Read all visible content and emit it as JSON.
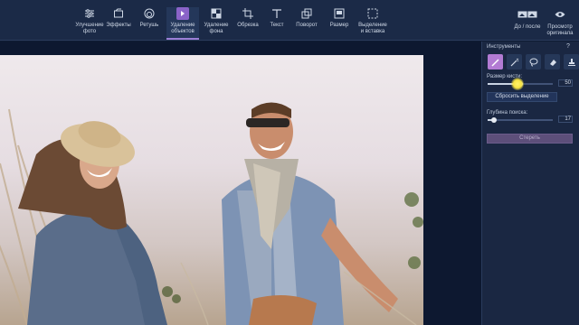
{
  "toolbar": {
    "items": [
      {
        "id": "enhance",
        "label_line1": "Улучшение",
        "label_line2": "фото",
        "icon": "sliders-icon"
      },
      {
        "id": "effects",
        "label_line1": "Эффекты",
        "label_line2": "",
        "icon": "effects-icon"
      },
      {
        "id": "retouch",
        "label_line1": "Ретушь",
        "label_line2": "",
        "icon": "retouch-icon"
      },
      {
        "id": "object-removal",
        "label_line1": "Удаление",
        "label_line2": "объектов",
        "icon": "eraser-icon",
        "active": true
      },
      {
        "id": "bg-removal",
        "label_line1": "Удаление",
        "label_line2": "фона",
        "icon": "background-icon"
      },
      {
        "id": "crop",
        "label_line1": "Обрезка",
        "label_line2": "",
        "icon": "crop-icon"
      },
      {
        "id": "text",
        "label_line1": "Текст",
        "label_line2": "",
        "icon": "text-icon"
      },
      {
        "id": "rotate",
        "label_line1": "Поворот",
        "label_line2": "",
        "icon": "rotate-icon"
      },
      {
        "id": "resize",
        "label_line1": "Размер",
        "label_line2": "",
        "icon": "resize-icon"
      },
      {
        "id": "select",
        "label_line1": "Выделение",
        "label_line2": "и вставка",
        "icon": "selection-icon"
      }
    ],
    "before_after": "До / после",
    "preview_line1": "Просмотр",
    "preview_line2": "оригинала"
  },
  "panel": {
    "title": "Инструменты",
    "help": "?",
    "tools": [
      "brush-icon",
      "magic-wand-icon",
      "lasso-icon",
      "eraser-tool-icon",
      "stamp-icon"
    ],
    "brush_size_label": "Размер кисти:",
    "brush_size_value": "50",
    "brush_size_fraction": 0.5,
    "reset_selection": "Сбросить выделение",
    "search_depth_label": "Глубина поиска:",
    "search_depth_value": "17",
    "search_depth_fraction": 0.1,
    "erase_button": "Стереть"
  },
  "colors": {
    "toolbar_bg": "#1b2a47",
    "panel_bg": "#1a2742",
    "accent": "#b27bd3",
    "erase_btn": "#5d4f7a"
  }
}
